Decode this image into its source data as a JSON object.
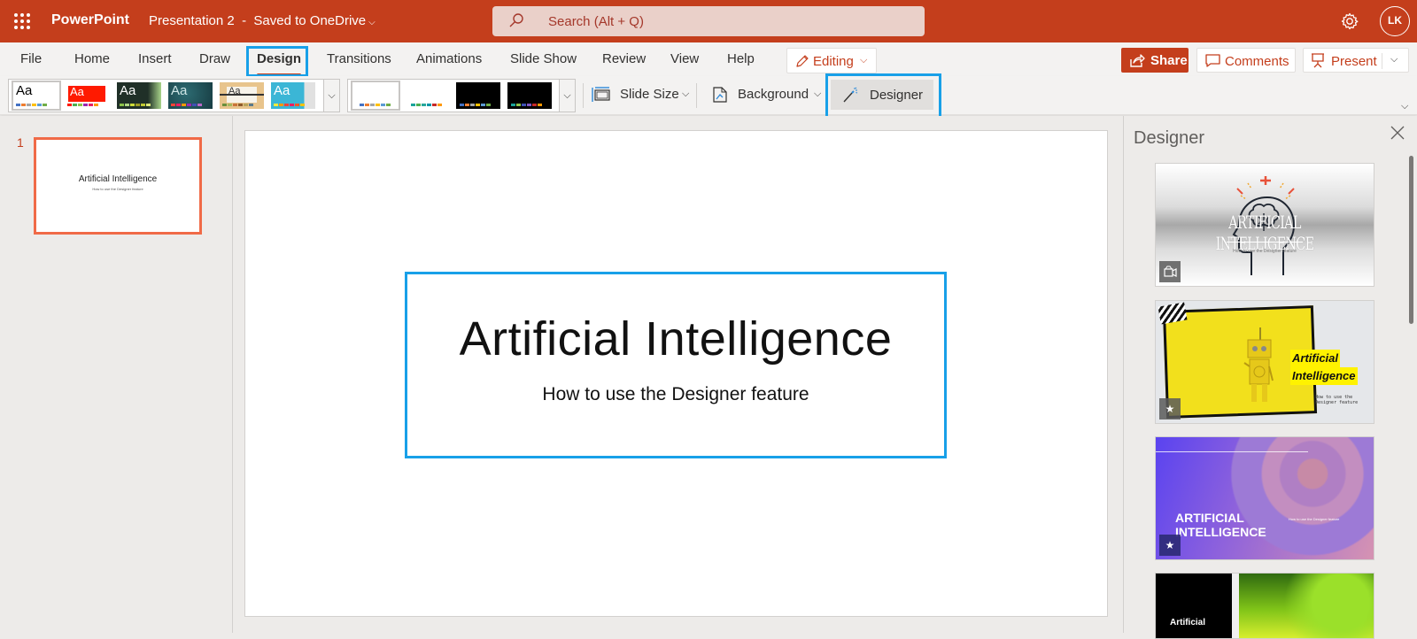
{
  "titlebar": {
    "app_name": "PowerPoint",
    "doc_title": "Presentation 2",
    "save_status": "Saved to OneDrive",
    "doc_title_full": "Presentation 2  -  Saved to OneDrive",
    "search_placeholder": "Search (Alt + Q)",
    "avatar_initials": "LK",
    "icons": [
      "app-launcher-icon",
      "search-icon",
      "settings-gear-icon"
    ]
  },
  "tabs": [
    {
      "label": "File",
      "active": false
    },
    {
      "label": "Home",
      "active": false
    },
    {
      "label": "Insert",
      "active": false
    },
    {
      "label": "Draw",
      "active": false
    },
    {
      "label": "Design",
      "active": true
    },
    {
      "label": "Transitions",
      "active": false
    },
    {
      "label": "Animations",
      "active": false
    },
    {
      "label": "Slide Show",
      "active": false
    },
    {
      "label": "Review",
      "active": false
    },
    {
      "label": "View",
      "active": false
    },
    {
      "label": "Help",
      "active": false
    }
  ],
  "mode_button": {
    "label": "Editing",
    "icon": "pencil-icon"
  },
  "actions": {
    "share": "Share",
    "comments": "Comments",
    "present": "Present"
  },
  "ribbon": {
    "themes": [
      {
        "name": "Office Theme",
        "glyph": "Aa",
        "bg": "#ffffff",
        "fg": "#000000"
      },
      {
        "name": "Red Theme",
        "glyph": "Aa",
        "bg": "#ff1a00",
        "fg": "#ffffff"
      },
      {
        "name": "Dark Green Theme",
        "glyph": "Aa",
        "bg": "#203028",
        "fg": "#ffffff"
      },
      {
        "name": "Teal Theme",
        "glyph": "Aa",
        "bg": "#1d4f55",
        "fg": "#cfe6e6"
      },
      {
        "name": "Wood Theme",
        "glyph": "Aa",
        "bg": "#e8c48c",
        "fg": "#333333"
      },
      {
        "name": "Blue Theme",
        "glyph": "Aa",
        "bg": "#3bb6d6",
        "fg": "#ffffff"
      }
    ],
    "variants": [
      {
        "bg": "#ffffff"
      },
      {
        "bg": "#ffffff"
      },
      {
        "bg": "#000000"
      },
      {
        "bg": "#000000"
      }
    ],
    "slide_size": "Slide Size",
    "background": "Background",
    "designer": "Designer"
  },
  "thumbnails": [
    {
      "number": "1",
      "title": "Artificial Intelligence",
      "subtitle": "How to use the Designer feature",
      "selected": true
    }
  ],
  "slide": {
    "title": "Artificial Intelligence",
    "subtitle": "How to use the Designer feature"
  },
  "designer_pane": {
    "title": "Designer",
    "cards": [
      {
        "title": "ARTIFICIAL INTELLIGENCE",
        "subtitle": "How to use the Designer feature",
        "badge": "video-icon"
      },
      {
        "title_line1": "Artificial",
        "title_line2": "Intelligence",
        "subtitle": "How to use the Designer feature",
        "badge": "star-icon"
      },
      {
        "title_line1": "ARTIFICIAL",
        "title_line2": "INTELLIGENCE",
        "subtitle": "How to use the Designer feature",
        "badge": "star-icon"
      },
      {
        "title": "Artificial"
      }
    ]
  },
  "colors": {
    "brand": "#c43e1c",
    "highlight": "#18a0e8",
    "selection": "#f06a47"
  }
}
